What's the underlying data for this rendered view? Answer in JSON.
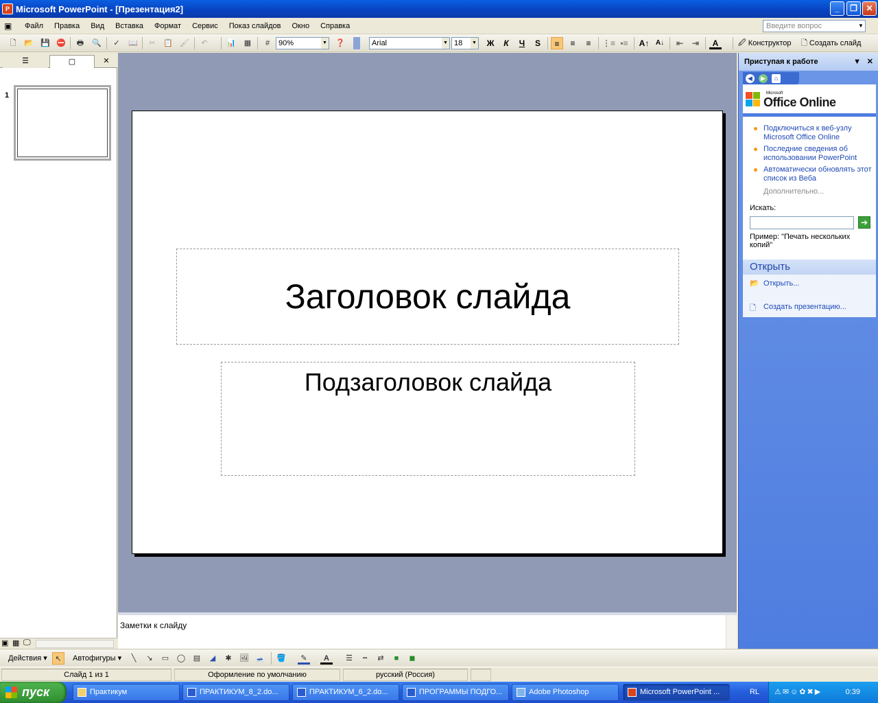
{
  "window": {
    "title": "Microsoft PowerPoint - [Презентация2]",
    "app_icon": "powerpoint-icon"
  },
  "menu": {
    "items": [
      "Файл",
      "Правка",
      "Вид",
      "Вставка",
      "Формат",
      "Сервис",
      "Показ слайдов",
      "Окно",
      "Справка"
    ],
    "ask_placeholder": "Введите вопрос"
  },
  "toolbar": {
    "zoom": "90%",
    "font": "Arial",
    "font_size": "18",
    "bold": "Ж",
    "italic": "К",
    "underline": "Ч",
    "shadow": "S",
    "designer_label": "Конструктор",
    "new_slide_label": "Создать слайд"
  },
  "slides_pane": {
    "slide_number": "1"
  },
  "slide": {
    "title": "Заголовок слайда",
    "subtitle": "Подзаголовок слайда"
  },
  "notes": {
    "placeholder": "Заметки к слайду"
  },
  "task_pane": {
    "title": "Приступая к работе",
    "logo_small": "Microsoft",
    "logo_big": "Office Online",
    "links": [
      "Подключиться к веб-узлу Microsoft Office Online",
      "Последние сведения об использовании PowerPoint",
      "Автоматически обновлять этот список из Веба"
    ],
    "more": "Дополнительно...",
    "search_label": "Искать:",
    "example_label": "Пример:",
    "example_text": "\"Печать нескольких копий\"",
    "open_section": "Открыть",
    "open_link": "Открыть...",
    "create_link": "Создать презентацию..."
  },
  "drawing": {
    "actions_label": "Действия",
    "autoshapes_label": "Автофигуры"
  },
  "status": {
    "slide": "Слайд 1 из 1",
    "design": "Оформление по умолчанию",
    "language": "русский (Россия)"
  },
  "taskbar": {
    "start": "пуск",
    "items": [
      "Практикум",
      "ПРАКТИКУМ_8_2.do...",
      "ПРАКТИКУМ_6_2.do...",
      "ПРОГРАММЫ ПОДГО...",
      "Adobe Photoshop",
      "Microsoft PowerPoint ..."
    ],
    "lang": "RL",
    "clock": "0:39"
  }
}
